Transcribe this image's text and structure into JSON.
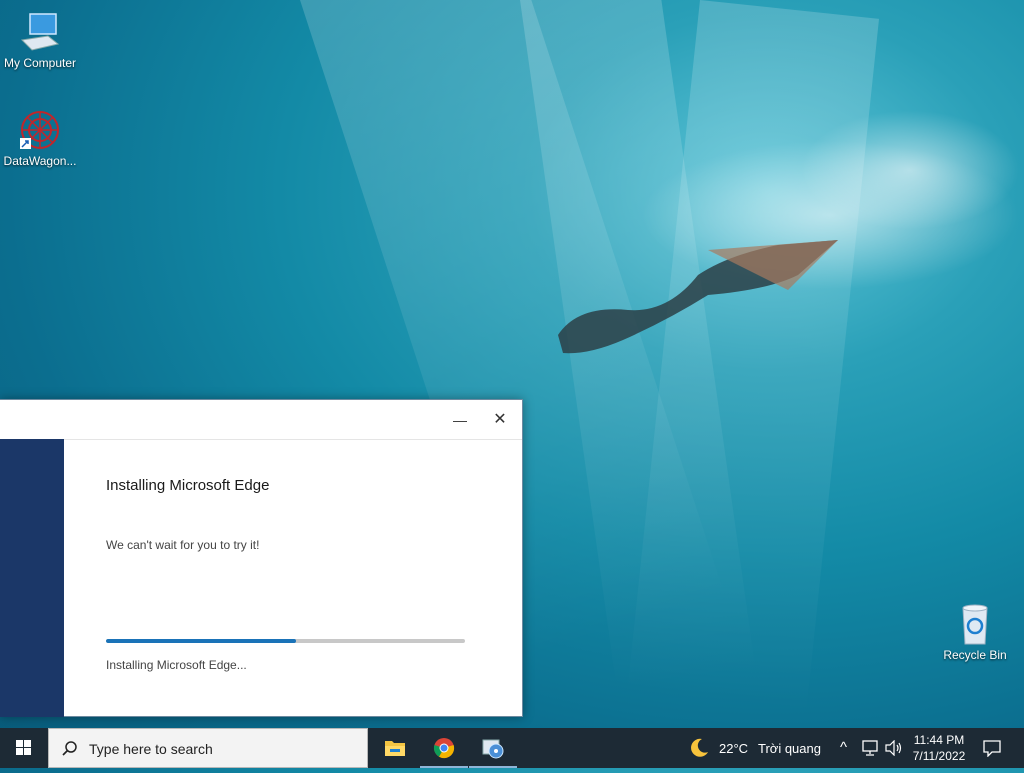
{
  "desktop": {
    "icons": [
      {
        "label": "My Computer",
        "icon": "computer-icon"
      },
      {
        "label": "DataWagon...",
        "icon": "datawagon-icon"
      },
      {
        "label": "Recycle Bin",
        "icon": "recycle-bin-icon"
      }
    ]
  },
  "installer": {
    "title": "Installing Microsoft Edge",
    "subtitle": "We can't wait for you to try it!",
    "status": "Installing Microsoft Edge...",
    "progress": 0.53,
    "minimize_glyph": "—",
    "close_glyph": "✕",
    "accent_color": "#1a73b8",
    "side_color": "#1b3768"
  },
  "taskbar": {
    "search_placeholder": "Type here to search",
    "apps": [
      {
        "name": "file-explorer-icon"
      },
      {
        "name": "chrome-icon"
      },
      {
        "name": "installer-app-icon"
      }
    ],
    "weather": {
      "temp": "22°C",
      "condition": "Trời quang",
      "icon": "moon-icon"
    },
    "clock": {
      "time": "11:44 PM",
      "date": "7/11/2022"
    },
    "tray_chevron": "^"
  }
}
